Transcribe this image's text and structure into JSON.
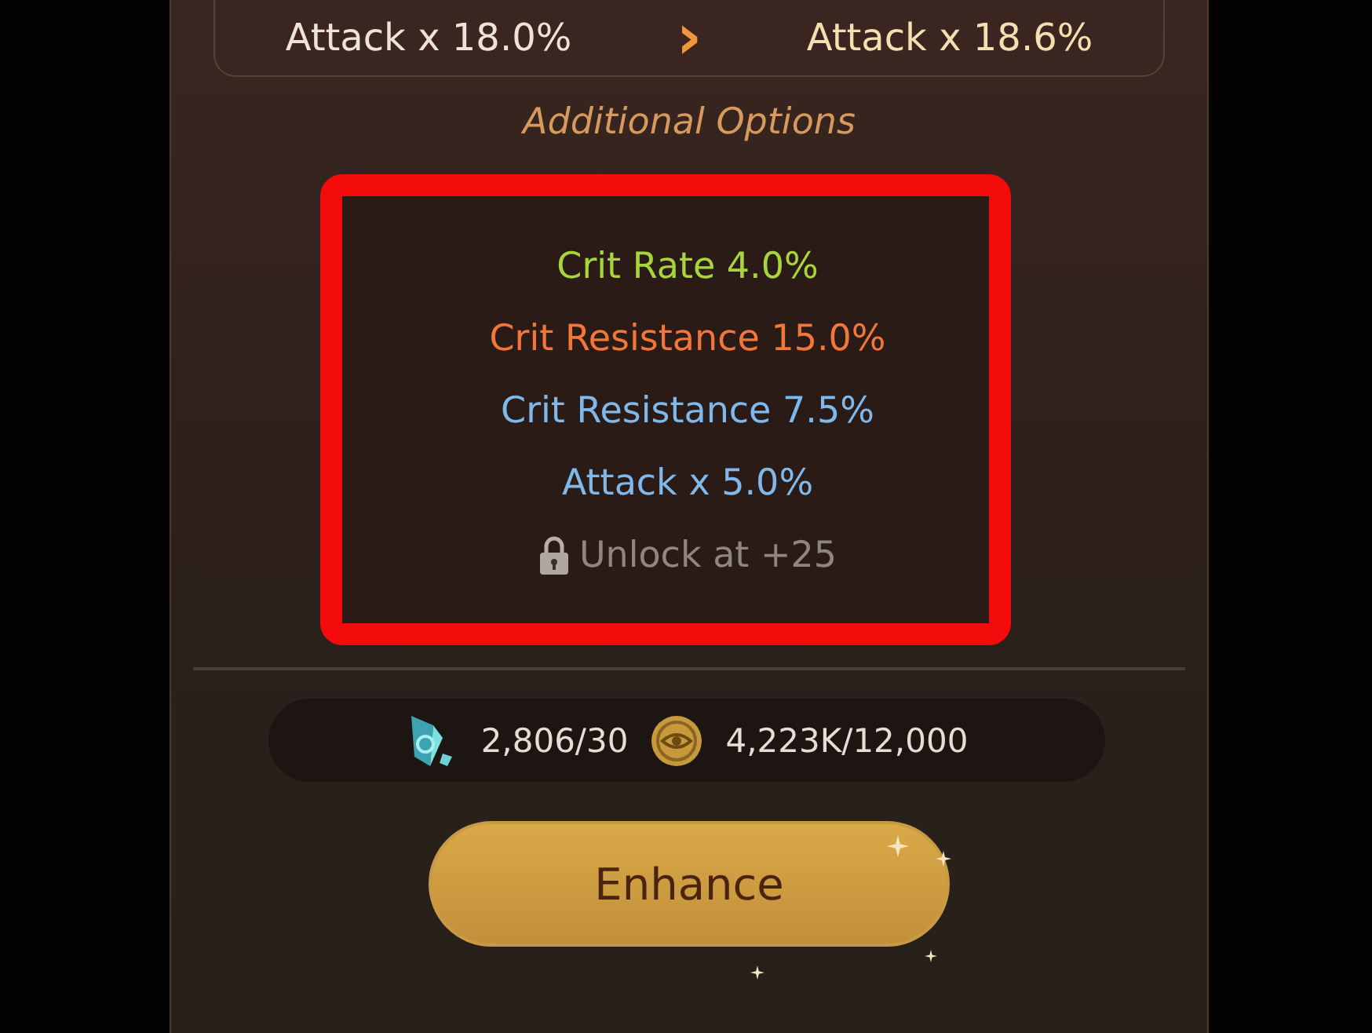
{
  "stat_change": {
    "current": "Attack x 18.0%",
    "arrow": "›",
    "next": "Attack x 18.6%"
  },
  "section_title": "Additional Options",
  "options_highlighted": true,
  "options": [
    {
      "kind": "stat",
      "text": "Crit Rate 4.0%",
      "color": "#a8d63a"
    },
    {
      "kind": "stat",
      "text": "Crit Resistance 15.0%",
      "color": "#f0763a"
    },
    {
      "kind": "stat",
      "text": "Crit Resistance 7.5%",
      "color": "#7fb8ea"
    },
    {
      "kind": "stat",
      "text": "Attack x 5.0%",
      "color": "#7fb8ea"
    },
    {
      "kind": "locked",
      "text": "Unlock at +25"
    }
  ],
  "costs": [
    {
      "kind": "crystal",
      "text": "2,806/30"
    },
    {
      "kind": "coin",
      "text": "4,223K/12,000"
    }
  ],
  "button": "Enhance"
}
